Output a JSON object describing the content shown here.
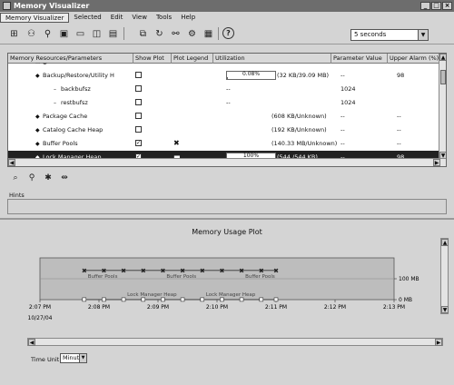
{
  "window": {
    "title": "Memory Visualizer"
  },
  "menu": [
    "Memory Visualizer",
    "Selected",
    "Edit",
    "View",
    "Tools",
    "Help"
  ],
  "toolbar": {
    "icons": [
      "tree-icon",
      "network-icon",
      "filter-icon",
      "database-icon",
      "window-icon",
      "disk-icon",
      "monitor-icon",
      "view-icon",
      "refresh-icon",
      "graph-icon",
      "settings-icon",
      "log-icon",
      "help-icon"
    ],
    "help_label": "?",
    "interval": "5 seconds"
  },
  "table": {
    "columns": [
      "Memory Resources/Parameters",
      "Show Plot",
      "Plot Legend",
      "Utilization",
      "Parameter Value",
      "Upper Alarm (%)"
    ],
    "rows": [
      {
        "name": "Backup/Restore/Utility H",
        "indent": 2,
        "show_plot": false,
        "legend": "",
        "util_pct": 0.08,
        "util_label": "0.08%",
        "util_text": "(32 KB/39.09 MB)",
        "param": "--",
        "alarm": "98",
        "bar": true
      },
      {
        "name": "backbufsz",
        "indent": 3,
        "show_plot": false,
        "legend": "",
        "util_pct": null,
        "util_label": "",
        "util_text": "--",
        "param": "1024",
        "alarm": "",
        "bar": false
      },
      {
        "name": "restbufsz",
        "indent": 3,
        "show_plot": false,
        "legend": "",
        "util_pct": null,
        "util_label": "",
        "util_text": "--",
        "param": "1024",
        "alarm": "",
        "bar": false
      },
      {
        "name": "Package Cache",
        "indent": 2,
        "show_plot": false,
        "legend": "",
        "util_pct": null,
        "util_label": "",
        "util_text": "(608 KB/Unknown)",
        "param": "--",
        "alarm": "--",
        "bar": false
      },
      {
        "name": "Catalog Cache Heap",
        "indent": 2,
        "show_plot": false,
        "legend": "",
        "util_pct": null,
        "util_label": "",
        "util_text": "(192 KB/Unknown)",
        "param": "--",
        "alarm": "--",
        "bar": false
      },
      {
        "name": "Buffer Pools",
        "indent": 2,
        "show_plot": true,
        "legend": "✖",
        "util_pct": null,
        "util_label": "",
        "util_text": "(140.33 MB/Unknown)",
        "param": "--",
        "alarm": "--",
        "bar": false
      },
      {
        "name": "Lock Manager Heap",
        "indent": 2,
        "show_plot": true,
        "legend": "▬",
        "util_pct": 100,
        "util_label": "100%",
        "util_text": "(544 /544 KB)",
        "param": "--",
        "alarm": "98",
        "bar": true,
        "selected": true
      }
    ]
  },
  "hints": {
    "label": "Hints"
  },
  "chart_data": {
    "type": "line",
    "title": "Memory Usage Plot",
    "xlabel": "",
    "ylabel": "",
    "x_ticks": [
      "2:07 PM",
      "2:08 PM",
      "2:09 PM",
      "2:10 PM",
      "2:11 PM",
      "2:12 PM",
      "2:13 PM"
    ],
    "y_ticks": [
      "100 MB",
      "0 MB"
    ],
    "date_label": "10/27/04",
    "series": [
      {
        "name": "Buffer Pools",
        "marker": "x",
        "x": [
          "2:07:45",
          "2:08:05",
          "2:08:25",
          "2:08:45",
          "2:09:05",
          "2:09:25",
          "2:09:45",
          "2:10:05",
          "2:10:25",
          "2:10:45",
          "2:11:00"
        ],
        "values_mb": [
          140,
          140,
          140,
          140,
          140,
          140,
          140,
          140,
          140,
          140,
          140
        ],
        "labels": [
          "Buffer Pools",
          "Buffer Pools",
          "Buffer Pools"
        ]
      },
      {
        "name": "Lock Manager Heap",
        "marker": "square",
        "x": [
          "2:07:45",
          "2:08:05",
          "2:08:25",
          "2:08:45",
          "2:09:05",
          "2:09:25",
          "2:09:45",
          "2:10:05",
          "2:10:25",
          "2:10:45",
          "2:11:00"
        ],
        "values_mb": [
          0.53,
          0.53,
          0.53,
          0.53,
          0.53,
          0.53,
          0.53,
          0.53,
          0.53,
          0.53,
          0.53
        ],
        "labels": [
          "Lock Manager Heap",
          "Lock Manager Heap"
        ]
      }
    ]
  },
  "time_unit": {
    "label": "Time Unit",
    "value": "Minute"
  }
}
